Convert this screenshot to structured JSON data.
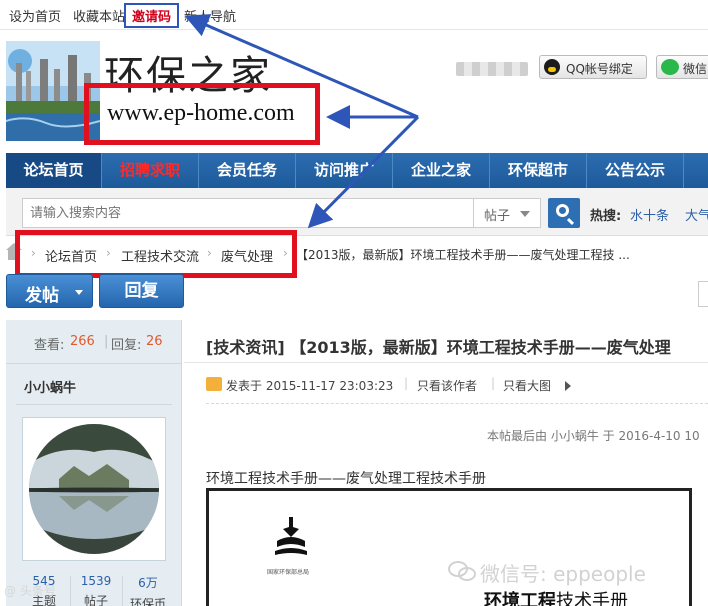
{
  "toplinks": {
    "set_home": "设为首页",
    "bookmark": "收藏本站",
    "invite": "邀请码",
    "new_nav": "新人导航"
  },
  "header": {
    "site_name": "环保之家",
    "site_url": "www.ep-home.com",
    "qq_bind": "QQ帐号绑定",
    "wechat": "微信"
  },
  "nav": {
    "items": [
      "论坛首页",
      "招聘求职",
      "会员任务",
      "访问推广",
      "企业之家",
      "环保超市",
      "公告公示"
    ]
  },
  "search": {
    "placeholder": "请输入搜索内容",
    "scope": "帖子",
    "hot_label": "热搜:",
    "hot_items": [
      "水十条",
      "大气十"
    ]
  },
  "breadcrumb": {
    "items": [
      "论坛首页",
      "工程技术交流",
      "废气处理"
    ],
    "current": "【2013版，最新版】环境工程技术手册——废气处理工程技 ..."
  },
  "actions": {
    "post": "发帖",
    "reply": "回复"
  },
  "thread_stats": {
    "views_label": "查看:",
    "views": "266",
    "replies_label": "回复:",
    "replies": "26"
  },
  "author": {
    "name": "小小蜗牛",
    "stats": [
      {
        "value": "545",
        "label": "主题"
      },
      {
        "value": "1539",
        "label": "帖子"
      },
      {
        "value": "6万",
        "label": "环保币"
      }
    ]
  },
  "post": {
    "title": "[技术资讯] 【2013版，最新版】环境工程技术手册——废气处理",
    "posted": "发表于 2015-11-17 23:03:23",
    "only_author": "只看该作者",
    "only_image": "只看大图",
    "edit_note": "本帖最后由 小小蜗牛 于 2016-4-10 10",
    "body_line": "环境工程技术手册——废气处理工程技术手册",
    "book_title_bold": "环境工程",
    "book_title_rest": "技术手册",
    "book_caption": "国家环保部总局"
  },
  "watermarks": {
    "wechat": "微信号: eppeople",
    "corner": "@ 头条号"
  },
  "colors": {
    "nav_blue": "#1d5a9a",
    "annotation_red": "#e0101e",
    "annotation_arrow": "#2d56b8",
    "hot_red": "#ff2a2a"
  }
}
